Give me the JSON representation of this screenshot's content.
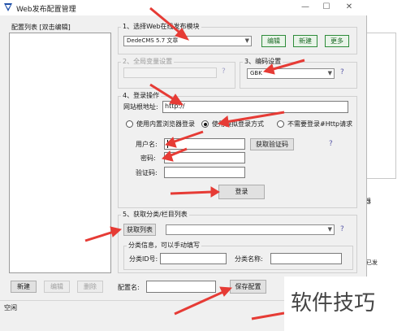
{
  "window": {
    "title": "Web发布配置管理",
    "minimize": "—",
    "maximize": "☐",
    "close": "✕"
  },
  "left_panel": {
    "title": "配置列表 [双击编辑]"
  },
  "section1": {
    "title": "1、选择Web在线发布模块",
    "module_value": "DedeCMS 5.7 文章",
    "edit_label": "编辑",
    "new_label": "新建",
    "more_label": "更多"
  },
  "section2": {
    "title": "2、全局变量设置",
    "help": "?"
  },
  "section3": {
    "title": "3、编码设置",
    "encoding_value": "GBK",
    "help": "?"
  },
  "section4": {
    "title": "4、登录操作",
    "site_label": "网站根地址:",
    "site_value": "http://",
    "radio_builtin": "使用内置浏览器登录",
    "radio_simulated": "使用模拟登录方式",
    "radio_none": "不需要登录#Http请求",
    "username_label": "用户名:",
    "password_label": "密码:",
    "captcha_label": "验证码:",
    "get_captcha_label": "获取验证码",
    "help": "?",
    "login_label": "登录"
  },
  "section5": {
    "title": "5、获取分类/栏目列表",
    "get_list_label": "获取列表",
    "help": "?",
    "info_title": "分类信息，可以手动填写",
    "cat_id_label": "分类ID号:",
    "cat_name_label": "分类名称:"
  },
  "bottom": {
    "new_label": "新建",
    "edit_label": "编辑",
    "delete_label": "删除",
    "config_name_label": "配置名:",
    "save_label": "保存配置"
  },
  "status": {
    "text": "空闲"
  },
  "background": {
    "side_text": "已发",
    "side_char": "器"
  },
  "watermark": {
    "text": "软件技巧"
  },
  "colors": {
    "arrow": "#e63b35",
    "accent": "#2e8b3a"
  }
}
